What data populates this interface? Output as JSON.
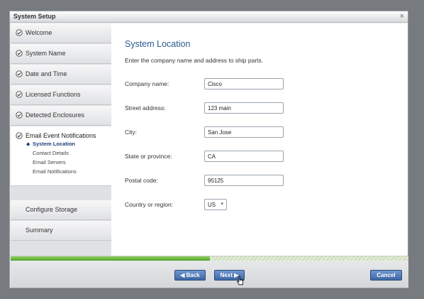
{
  "dialog": {
    "title": "System Setup",
    "close_glyph": "×"
  },
  "sidebar": {
    "items": [
      {
        "label": "Welcome",
        "icon": "check-circle-icon"
      },
      {
        "label": "System Name",
        "icon": "check-circle-icon"
      },
      {
        "label": "Date and Time",
        "icon": "check-circle-icon"
      },
      {
        "label": "Licensed Functions",
        "icon": "check-circle-icon"
      },
      {
        "label": "Detected Enclosures",
        "icon": "check-circle-icon"
      }
    ],
    "current": {
      "label": "Email Event Notifications",
      "icon": "check-circle-icon",
      "arrow": "◆",
      "subitems": [
        "System Location",
        "Contact Details",
        "Email Servers",
        "Email Notifications"
      ]
    },
    "upcoming": [
      "Configure Storage",
      "Summary"
    ]
  },
  "main": {
    "heading": "System Location",
    "intro": "Enter the company name and address to ship parts.",
    "fields": [
      {
        "label": "Company name:",
        "value": "Cisco"
      },
      {
        "label": "Street address:",
        "value": "123 main"
      },
      {
        "label": "City:",
        "value": "San Jose"
      },
      {
        "label": "State or province:",
        "value": "CA"
      },
      {
        "label": "Postal code:",
        "value": "95125"
      }
    ],
    "country": {
      "label": "Country or region:",
      "value": "US",
      "dropdown_glyph": "▾"
    }
  },
  "progress": {
    "fraction": 0.5
  },
  "footer": {
    "back_label": "◀ Back",
    "next_label": "Next ▶",
    "cancel_label": "Cancel"
  },
  "colors": {
    "accent": "#3e67a6",
    "heading": "#2a5a8f",
    "progress": "#4da52a"
  }
}
